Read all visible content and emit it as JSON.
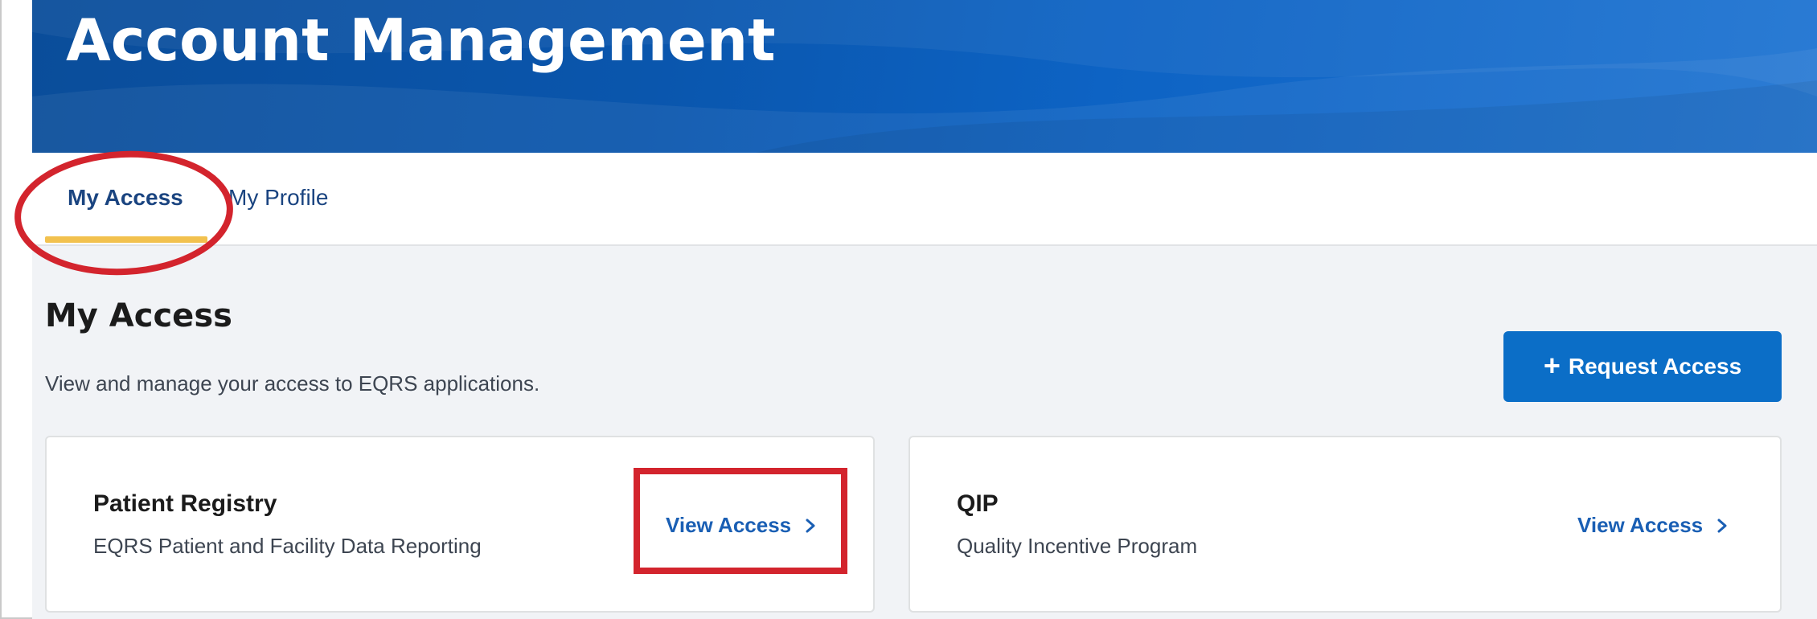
{
  "header": {
    "title": "Account Management"
  },
  "tabs": [
    {
      "label": "My Access",
      "active": true
    },
    {
      "label": "My Profile",
      "active": false
    }
  ],
  "main": {
    "title": "My Access",
    "description": "View and manage your access to EQRS applications.",
    "request_button": {
      "icon": "plus-icon",
      "label": "Request Access"
    },
    "cards": [
      {
        "title": "Patient Registry",
        "subtitle": "EQRS Patient and Facility Data Reporting",
        "link_label": "View Access",
        "link_icon": "chevron-right-icon"
      },
      {
        "title": "QIP",
        "subtitle": "Quality Incentive Program",
        "link_label": "View Access",
        "link_icon": "chevron-right-icon"
      }
    ]
  },
  "colors": {
    "banner": "#0a56ad",
    "tab_active_underline": "#f2c14e",
    "primary_button": "#0b6ec7",
    "link": "#1a5fb4",
    "annotation": "#d3242d"
  }
}
